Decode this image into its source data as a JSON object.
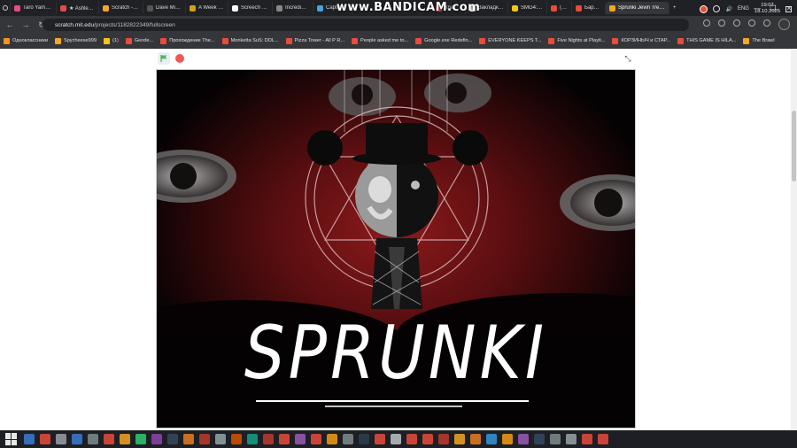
{
  "recorder_overlay": "www.BANDICAM.com",
  "tabs": [
    {
      "label": "Taro Yamada",
      "color": "#e94b8a"
    },
    {
      "label": "★ Ashley Gre",
      "color": "#e44b4b"
    },
    {
      "label": "Scratch - Фан",
      "color": "#f5a623"
    },
    {
      "label": "Dave Microw",
      "color": "#555555"
    },
    {
      "label": "A Week with",
      "color": "#d4a017"
    },
    {
      "label": "Screech | DO",
      "color": "#ffffff"
    },
    {
      "label": "Incredibox W",
      "color": "#888888"
    },
    {
      "label": "Capture",
      "color": "#4aa3df"
    },
    {
      "label": "Кра",
      "color": "#c0392b"
    },
    {
      "label": "Закладки: Эл",
      "color": "#ffffff"
    },
    {
      "label": "SMG4: SMG4",
      "color": "#f5c518"
    },
    {
      "label": "(14)",
      "color": "#e74c3c"
    },
    {
      "label": "Барбоскины",
      "color": "#e74c3c"
    },
    {
      "label": "Sprunki Jevin Treatme",
      "color": "#f5a623"
    }
  ],
  "new_tab": "+",
  "address": {
    "host": "scratch.mit.edu",
    "path": "/projects/1182822349/fullscreen"
  },
  "bookmarks": [
    {
      "label": "Одноклассники",
      "color": "#f7931e"
    },
    {
      "label": "Spycheese999",
      "color": "#f5a623"
    },
    {
      "label": "(1)",
      "color": "#f5c518"
    },
    {
      "label": "Geode...",
      "color": "#e74c3c"
    },
    {
      "label": "Прохождение The...",
      "color": "#e74c3c"
    },
    {
      "label": "Monketta SuS: DDL...",
      "color": "#e74c3c"
    },
    {
      "label": "Pizza Tower - All P R...",
      "color": "#e74c3c"
    },
    {
      "label": "People asked me to...",
      "color": "#e74c3c"
    },
    {
      "label": "Google.exe Redefin...",
      "color": "#e74c3c"
    },
    {
      "label": "EVERYONE KEEPS T...",
      "color": "#e74c3c"
    },
    {
      "label": "Five Nights at Playti...",
      "color": "#e74c3c"
    },
    {
      "label": "КОРЗИНЫЧ и СТАР...",
      "color": "#e74c3c"
    },
    {
      "label": "THIS GAME IS HILA...",
      "color": "#e74c3c"
    },
    {
      "label": "The Brawl",
      "color": "#f5a623"
    }
  ],
  "stage": {
    "title_text": "SPRUNKI"
  },
  "taskbar": {
    "icon_colors": [
      "#3a7bd5",
      "#e74c3c",
      "#9aa0a6",
      "#3a7bd5",
      "#7f8c8d",
      "#e74c3c",
      "#f5a623",
      "#2ecc71",
      "#8e44ad",
      "#34495e",
      "#e67e22",
      "#c0392b",
      "#95a5a6",
      "#d35400",
      "#16a085",
      "#c0392b",
      "#e74c3c",
      "#9b59b6",
      "#e74c3c",
      "#f39c12",
      "#7f8c8d",
      "#2c3e50",
      "#e74c3c",
      "#bdc3c7",
      "#e74c3c",
      "#e74c3c",
      "#c0392b",
      "#f5a623",
      "#e67e22",
      "#3498db",
      "#f39c12",
      "#9b59b6",
      "#34495e",
      "#7f8c8d",
      "#95a5a6",
      "#e74c3c",
      "#e74c3c",
      "#27ae60"
    ],
    "lang": "ENG",
    "time": "19:07",
    "date": "18.10.2025"
  }
}
